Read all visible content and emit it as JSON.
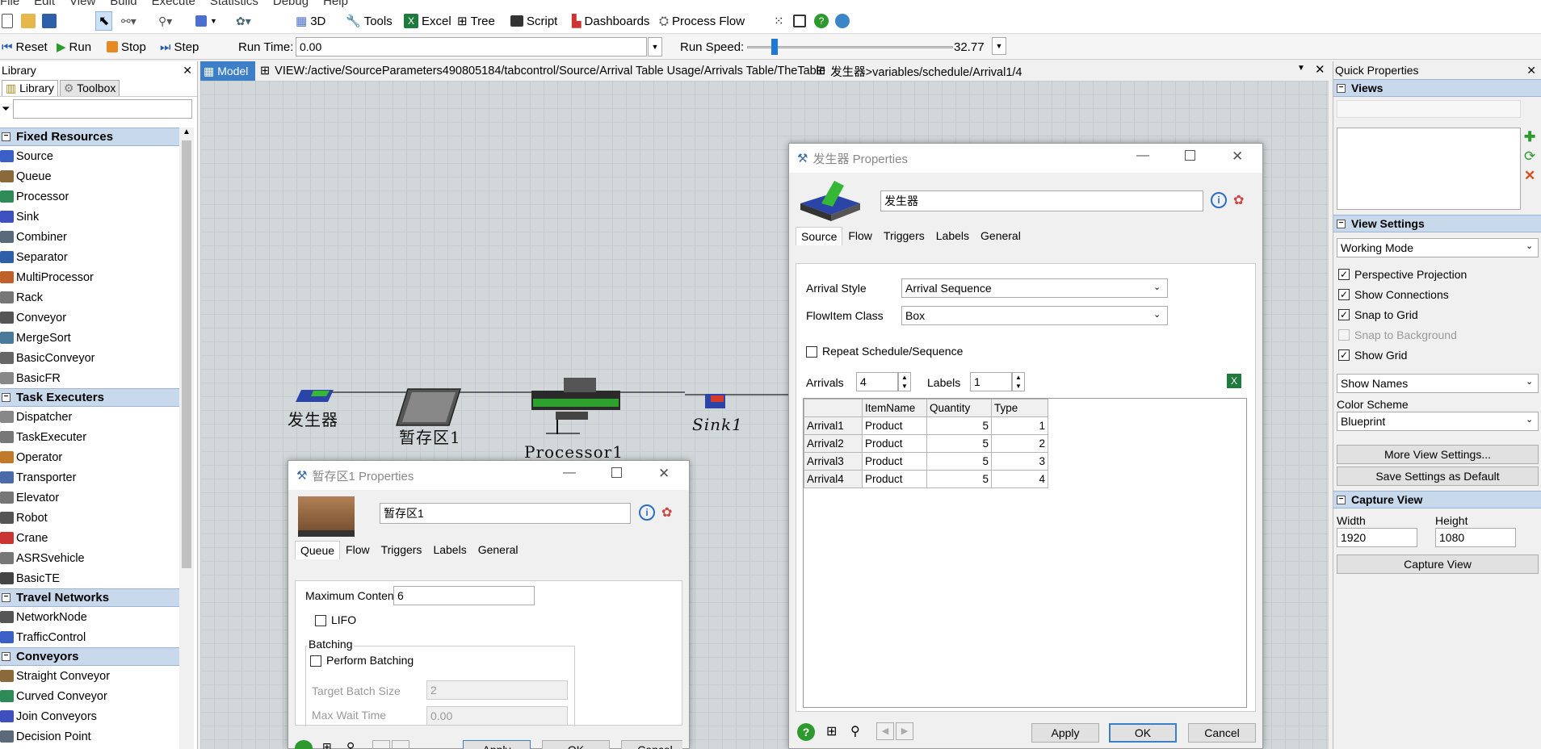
{
  "menubar": [
    "File",
    "Edit",
    "View",
    "Build",
    "Execute",
    "Statistics",
    "Debug",
    "Help"
  ],
  "toolbar": {
    "view3d": "3D",
    "tools": "Tools",
    "excel": "Excel",
    "tree": "Tree",
    "script": "Script",
    "dashboards": "Dashboards",
    "process_flow": "Process Flow"
  },
  "runbar": {
    "reset": "Reset",
    "run": "Run",
    "stop": "Stop",
    "step": "Step",
    "run_time_label": "Run Time:",
    "run_time": "0.00",
    "run_speed_label": "Run Speed:",
    "run_speed": "32.77"
  },
  "library": {
    "title": "Library",
    "tabs": [
      "Library",
      "Toolbox"
    ],
    "categories": [
      {
        "name": "Fixed Resources",
        "items": [
          "Source",
          "Queue",
          "Processor",
          "Sink",
          "Combiner",
          "Separator",
          "MultiProcessor",
          "Rack",
          "Conveyor",
          "MergeSort",
          "BasicConveyor",
          "BasicFR"
        ]
      },
      {
        "name": "Task Executers",
        "items": [
          "Dispatcher",
          "TaskExecuter",
          "Operator",
          "Transporter",
          "Elevator",
          "Robot",
          "Crane",
          "ASRSvehicle",
          "BasicTE"
        ]
      },
      {
        "name": "Travel Networks",
        "items": [
          "NetworkNode",
          "TrafficControl"
        ]
      },
      {
        "name": "Conveyors",
        "items": [
          "Straight Conveyor",
          "Curved Conveyor",
          "Join Conveyors",
          "Decision Point"
        ]
      }
    ]
  },
  "view_tabs": [
    "Model",
    "VIEW:/active/SourceParameters490805184/tabcontrol/Source/Arrival Table Usage/Arrivals Table/TheTable",
    "发生器>variables/schedule/Arrival1/4"
  ],
  "model_objects": {
    "source": "发生器",
    "queue": "暂存区1",
    "processor": "Processor1",
    "sink": "Sink1"
  },
  "source_dialog": {
    "title": "发生器  Properties",
    "name": "发生器",
    "tabs": [
      "Source",
      "Flow",
      "Triggers",
      "Labels",
      "General"
    ],
    "arrival_style_label": "Arrival Style",
    "arrival_style": "Arrival Sequence",
    "flowitem_class_label": "FlowItem Class",
    "flowitem_class": "Box",
    "repeat_label": "Repeat Schedule/Sequence",
    "arrivals_label": "Arrivals",
    "arrivals": "4",
    "labels_label": "Labels",
    "labels": "1",
    "table": {
      "columns": [
        "ItemName",
        "Quantity",
        "Type"
      ],
      "rows": [
        {
          "h": "Arrival1",
          "c": [
            "Product",
            "5",
            "1"
          ]
        },
        {
          "h": "Arrival2",
          "c": [
            "Product",
            "5",
            "2"
          ]
        },
        {
          "h": "Arrival3",
          "c": [
            "Product",
            "5",
            "3"
          ]
        },
        {
          "h": "Arrival4",
          "c": [
            "Product",
            "5",
            "4"
          ]
        }
      ]
    },
    "buttons": {
      "apply": "Apply",
      "ok": "OK",
      "cancel": "Cancel"
    }
  },
  "queue_dialog": {
    "title": "暂存区1  Properties",
    "name": "暂存区1",
    "tabs": [
      "Queue",
      "Flow",
      "Triggers",
      "Labels",
      "General"
    ],
    "max_content_label": "Maximum Content",
    "max_content": "6",
    "lifo_label": "LIFO",
    "batching_label": "Batching",
    "perform_batching_label": "Perform Batching",
    "target_batch_label": "Target Batch Size",
    "target_batch": "2",
    "max_wait_label": "Max Wait Time",
    "max_wait": "0.00",
    "buttons": {
      "apply": "Apply",
      "ok": "OK",
      "cancel": "Cancel"
    }
  },
  "quick_props": {
    "title": "Quick Properties",
    "views_label": "Views",
    "view_settings_label": "View Settings",
    "working_mode": "Working Mode",
    "checks": [
      {
        "label": "Perspective Projection",
        "checked": true
      },
      {
        "label": "Show Connections",
        "checked": true
      },
      {
        "label": "Snap to Grid",
        "checked": true
      },
      {
        "label": "Snap to Background",
        "checked": false
      },
      {
        "label": "Show Grid",
        "checked": true
      }
    ],
    "show_names": "Show Names",
    "color_scheme_label": "Color Scheme",
    "color_scheme": "Blueprint",
    "more_view_settings": "More View Settings...",
    "save_default": "Save Settings as Default",
    "capture_view_label": "Capture View",
    "width_label": "Width",
    "width": "1920",
    "height_label": "Height",
    "height": "1080",
    "capture_button": "Capture View"
  }
}
